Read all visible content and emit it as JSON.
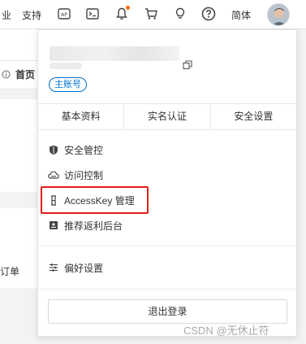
{
  "topbar": {
    "partial_left": "业",
    "support": "支持",
    "lang": "简体"
  },
  "background": {
    "home_tab": "首页",
    "order_partial": "订单"
  },
  "dropdown": {
    "main_account_badge": "主账号",
    "tabs": [
      {
        "label": "基本资料"
      },
      {
        "label": "实名认证"
      },
      {
        "label": "安全设置"
      }
    ],
    "menu": [
      {
        "label": "安全管控",
        "icon": "shield-icon"
      },
      {
        "label": "访问控制",
        "icon": "cloud-icon"
      },
      {
        "label": "AccessKey 管理",
        "icon": "key-icon"
      },
      {
        "label": "推荐返利后台",
        "icon": "gift-icon"
      },
      {
        "label": "偏好设置",
        "icon": "sliders-icon"
      }
    ],
    "logout": "退出登录"
  },
  "watermark": "CSDN @无休止符",
  "colors": {
    "accent": "#0070cc",
    "highlight": "#e0201a",
    "notification": "#ff6a00"
  }
}
